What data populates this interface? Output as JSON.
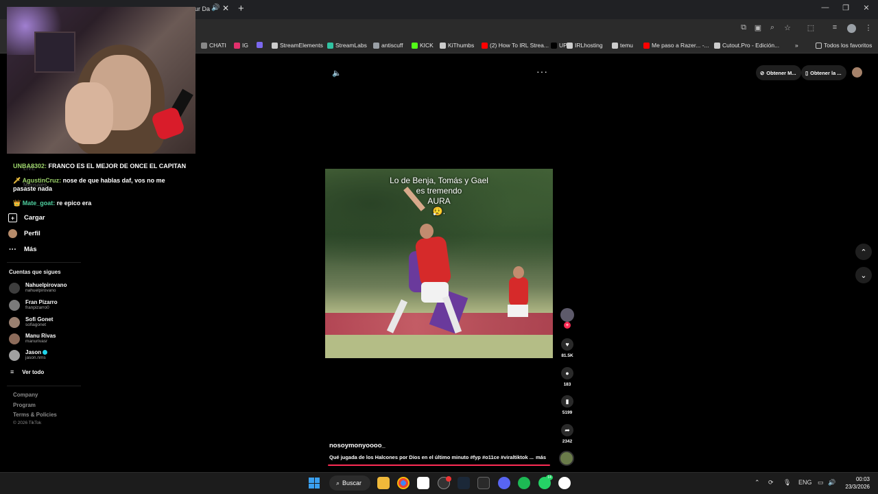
{
  "browser": {
    "tab_title": "ur Da",
    "bookmarks": [
      {
        "label": "CHATI",
        "color": "#888888"
      },
      {
        "label": "IG",
        "color": "#e1306c"
      },
      {
        "label": "",
        "color": "#7b68ee"
      },
      {
        "label": "StreamElements",
        "color": "#cccccc"
      },
      {
        "label": "StreamLabs",
        "color": "#31c3a2"
      },
      {
        "label": "antiscuff",
        "color": "#9aa0a6"
      },
      {
        "label": "KICK",
        "color": "#53fc18"
      },
      {
        "label": "KiThumbs",
        "color": "#cccccc"
      },
      {
        "label": "(2) How To IRL Strea...",
        "color": "#ff0000"
      },
      {
        "label": "UP",
        "color": "#000000"
      },
      {
        "label": "IRLhosting",
        "color": "#cccccc"
      },
      {
        "label": "temu",
        "color": "#cccccc"
      },
      {
        "label": "Me paso a Razer... -...",
        "color": "#ff0000"
      },
      {
        "label": "Cutout.Pro - Edición...",
        "color": "#cccccc"
      }
    ],
    "all_bookmarks": "Todos los favoritos"
  },
  "chat": [
    {
      "user": "UNBA8302:",
      "text": "FRANCO ES EL MEJOR DE ONCE EL CAPITAN"
    },
    {
      "user": "AgustinCruz:",
      "text": "nose de que hablas daf, vos no me",
      "cont": "pasaste nada"
    },
    {
      "user": "Mate_goat:",
      "text": "re epico era"
    }
  ],
  "sidebar": {
    "ghost_live": "LIVE",
    "ghost_messages": "Mensajes",
    "nav": [
      {
        "label": "Cargar",
        "icon": "upload-icon"
      },
      {
        "label": "Perfil",
        "icon": "profile-avatar"
      },
      {
        "label": "Más",
        "icon": "more-icon"
      }
    ],
    "following_title": "Cuentas que sigues",
    "following": [
      {
        "name": "Nahuelpirovano",
        "handle": "nahuelpirovano",
        "verified": false
      },
      {
        "name": "Fran Pizarro",
        "handle": "franpizarro0",
        "verified": false
      },
      {
        "name": "Sofi Gonet",
        "handle": "sofiagonet",
        "verified": false
      },
      {
        "name": "Manu Rivas",
        "handle": "manurivasr",
        "verified": false
      },
      {
        "name": "Jason",
        "handle": "jason.nms",
        "verified": true
      }
    ],
    "see_all": "Ver todo",
    "footer": [
      "Company",
      "Program",
      "Terms & Policies"
    ],
    "copyright": "© 2026 TikTok"
  },
  "top_actions": {
    "get_app": "Obtener M...",
    "get_app2": "Obtener la ..."
  },
  "video": {
    "caption_lines": [
      "Lo de Benja, Tomás y Gael",
      "es tremendo",
      "AURA",
      "😮‍💨."
    ],
    "likes": "81.5K",
    "comments": "183",
    "saves": "5199",
    "shares": "2342",
    "username": "nosoymonyoooo_",
    "description": "Qué jugada de los Halcones por Dios en el último minuto #fyp #o11ce #viraltiktok ...",
    "more": "más",
    "progress": 1.0
  },
  "taskbar": {
    "search": "Buscar",
    "lang": "ENG",
    "time": "00:03",
    "date": "23/3/2026",
    "whatsapp_badge": "14"
  },
  "colors": {
    "accent": "#fe2c55",
    "background": "#000000"
  }
}
